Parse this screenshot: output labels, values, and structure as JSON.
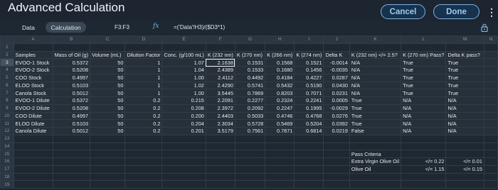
{
  "app": {
    "title": "Advanced Calculation"
  },
  "header": {
    "cancel_label": "Cancel",
    "done_label": "Done",
    "menu_icon": "more-vertical-icon"
  },
  "toolbar": {
    "tabs": [
      {
        "label": "Data"
      },
      {
        "label": "Calculation"
      }
    ],
    "cell_ref": "F3:F3",
    "fx_label": "fx",
    "formula": "=('Data'!H3)/($D3*1)",
    "lock_icon": "lock-icon"
  },
  "sheet": {
    "columns": [
      "",
      "A",
      "B",
      "C",
      "D",
      "E",
      "F",
      "G",
      "H",
      "I",
      "J",
      "K",
      "L",
      "M",
      "N"
    ],
    "selected_cell": "F3",
    "rows": [
      {
        "n": "1",
        "cells": [
          "",
          "",
          "",
          "",
          "",
          "",
          "",
          "",
          "",
          "",
          "",
          "",
          "",
          ""
        ]
      },
      {
        "n": "2",
        "cells": [
          "Samples",
          "Mass of Oil (g)",
          "Volume (mL)",
          "Dilution Factor",
          "Conc. (g/100 mL)",
          "K (232 nm)",
          "K (270 nm)",
          "K (266 nm)",
          "K (274 nm)",
          "Delta K",
          "K (232 nm) </= 2.5?",
          "K (270 nm) Pass?",
          "Delta K pass?",
          ""
        ]
      },
      {
        "n": "3",
        "cells": [
          "EVOO-1 Stock",
          "0.5372",
          "50",
          "1",
          "1.07",
          "2.1638",
          "0.1531",
          "0.1568",
          "0.1521",
          "-0.0014",
          "N/A",
          "True",
          "True",
          ""
        ]
      },
      {
        "n": "4",
        "cells": [
          "EVOO-2 Stock",
          "0.5208",
          "50",
          "1",
          "1.04",
          "2.4389",
          "0.1533",
          "0.1680",
          "0.1456",
          "-0.0035",
          "N/A",
          "True",
          "True",
          ""
        ]
      },
      {
        "n": "5",
        "cells": [
          "COO Stock",
          "0.4997",
          "50",
          "1",
          "1.00",
          "2.4112",
          "0.4492",
          "0.4184",
          "0.4227",
          "0.0287",
          "N/A",
          "True",
          "True",
          ""
        ]
      },
      {
        "n": "6",
        "cells": [
          "ELOO Stock",
          "0.5103",
          "50",
          "1",
          "1.02",
          "2.4290",
          "0.5741",
          "0.5432",
          "0.5190",
          "0.0430",
          "N/A",
          "True",
          "True",
          ""
        ]
      },
      {
        "n": "7",
        "cells": [
          "Canola Stock",
          "0.5012",
          "50",
          "1",
          "1.00",
          "3.5445",
          "0.7869",
          "0.8203",
          "0.7071",
          "0.0231",
          "N/A",
          "True",
          "True",
          ""
        ]
      },
      {
        "n": "8",
        "cells": [
          "EVOO-1 Dilute",
          "0.5372",
          "50",
          "0.2",
          "0.215",
          "2.2091",
          "0.2277",
          "0.2324",
          "0.2241",
          "0.0005",
          "True",
          "N/A",
          "N/A",
          ""
        ]
      },
      {
        "n": "9",
        "cells": [
          "EVOO-2 Dilute",
          "0.5208",
          "50",
          "0.2",
          "0.208",
          "2.3972",
          "0.2092",
          "0.2247",
          "0.1995",
          "-0.0029",
          "True",
          "N/A",
          "N/A",
          ""
        ]
      },
      {
        "n": "10",
        "cells": [
          "COO Dilute",
          "0.4997",
          "50",
          "0.2",
          "0.200",
          "2.4403",
          "0.5033",
          "0.4746",
          "0.4768",
          "0.0276",
          "True",
          "N/A",
          "N/A",
          ""
        ]
      },
      {
        "n": "11",
        "cells": [
          "ELOO Dilute",
          "0.5103",
          "50",
          "0.2",
          "0.204",
          "2.3034",
          "0.5728",
          "0.5469",
          "0.5204",
          "0.0392",
          "True",
          "N/A",
          "N/A",
          ""
        ]
      },
      {
        "n": "12",
        "cells": [
          "Canola Dilute",
          "0.5012",
          "50",
          "0.2",
          "0.201",
          "3.5179",
          "0.7561",
          "0.7871",
          "0.6814",
          "0.0219",
          "False",
          "N/A",
          "N/A",
          ""
        ]
      },
      {
        "n": "13",
        "cells": [
          "",
          "",
          "",
          "",
          "",
          "",
          "",
          "",
          "",
          "",
          "",
          "",
          "",
          ""
        ]
      },
      {
        "n": "14",
        "cells": [
          "",
          "",
          "",
          "",
          "",
          "",
          "",
          "",
          "",
          "",
          "",
          "",
          "",
          ""
        ]
      },
      {
        "n": "15",
        "cells": [
          "",
          "",
          "",
          "",
          "",
          "",
          "",
          "",
          "",
          "",
          "Pass Criteria",
          "",
          "",
          ""
        ]
      },
      {
        "n": "16",
        "cells": [
          "",
          "",
          "",
          "",
          "",
          "",
          "",
          "",
          "",
          "",
          "Extra Virgin Olive Oil",
          "</= 0.22",
          "</= 0.01",
          ""
        ]
      },
      {
        "n": "17",
        "cells": [
          "",
          "",
          "",
          "",
          "",
          "",
          "",
          "",
          "",
          "",
          "Olive Oil",
          "</= 1.15",
          "</= 0.15",
          ""
        ]
      },
      {
        "n": "18",
        "cells": [
          "",
          "",
          "",
          "",
          "",
          "",
          "",
          "",
          "",
          "",
          "",
          "",
          "",
          ""
        ]
      },
      {
        "n": "19",
        "cells": [
          "",
          "",
          "",
          "",
          "",
          "",
          "",
          "",
          "",
          "",
          "",
          "",
          "",
          ""
        ]
      }
    ]
  }
}
